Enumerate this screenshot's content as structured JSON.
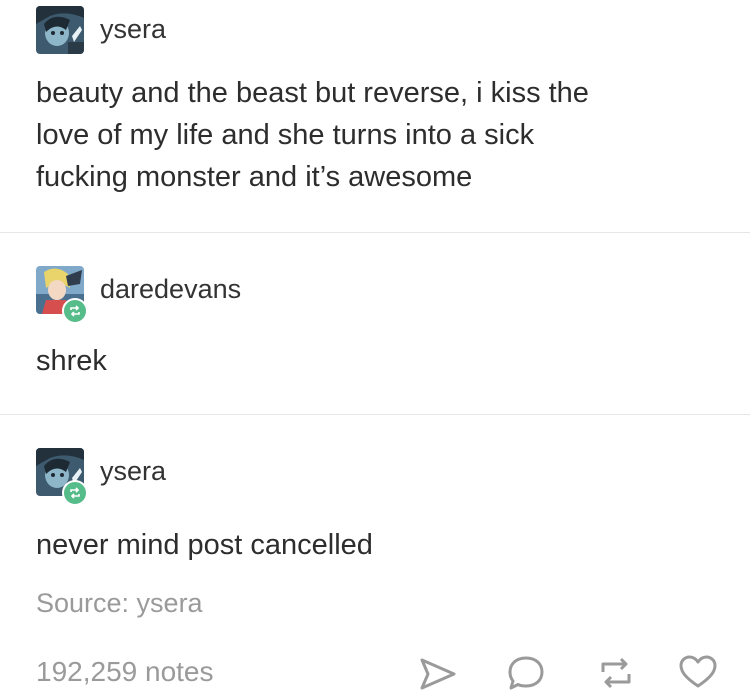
{
  "posts": [
    {
      "username": "ysera",
      "lines": [
        "beauty and the beast but reverse, i kiss the",
        "love of my life and she turns into a sick",
        "fucking monster and it’s awesome"
      ]
    },
    {
      "username": "daredevans",
      "lines": [
        "shrek"
      ]
    },
    {
      "username": "ysera",
      "lines": [
        "never mind post cancelled"
      ]
    }
  ],
  "source": "Source: ysera",
  "notes": "192,259 notes",
  "icons": {
    "share": "send-icon",
    "reply": "comment-icon",
    "reblog": "reblog-icon",
    "like": "heart-icon",
    "badge": "reblog-badge-icon"
  },
  "colors": {
    "reblog_badge": "#56bc8a",
    "meta_text": "#9a9a9a"
  }
}
